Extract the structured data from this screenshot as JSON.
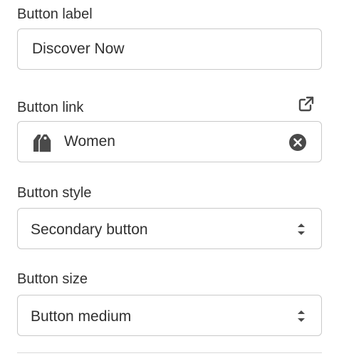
{
  "button_label": {
    "label": "Button label",
    "value": "Discover Now"
  },
  "button_link": {
    "label": "Button link",
    "value": "Women",
    "open_icon": "external-link-icon",
    "tag_icon": "tags-icon",
    "clear_icon": "clear-circle-icon"
  },
  "button_style": {
    "label": "Button style",
    "value": "Secondary button",
    "chevron_icon": "select-chevrons-icon"
  },
  "button_size": {
    "label": "Button size",
    "value": "Button medium",
    "chevron_icon": "select-chevrons-icon"
  }
}
